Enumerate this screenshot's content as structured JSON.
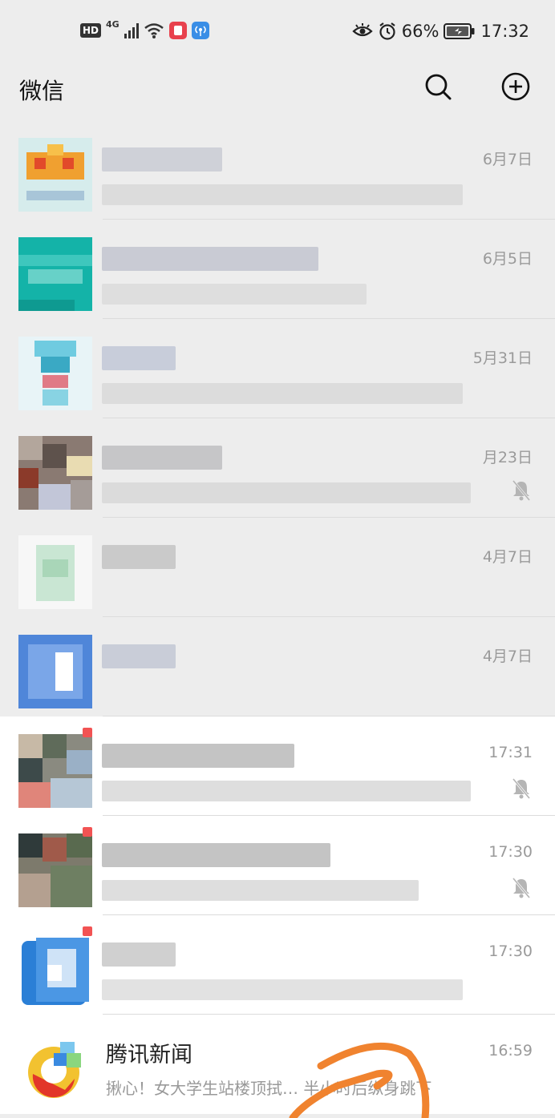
{
  "status_bar": {
    "hd": "HD",
    "network": "4G",
    "battery": "66%",
    "clock": "17:32",
    "icons": [
      "signal-icon",
      "wifi-icon",
      "app-notification-icon",
      "hotspot-icon",
      "eye-comfort-icon",
      "alarm-icon",
      "battery-icon"
    ]
  },
  "header": {
    "title": "微信",
    "icons": [
      "search-icon",
      "add-circle-icon"
    ]
  },
  "chats": [
    {
      "time": "6月7日",
      "muted": false,
      "unread": false
    },
    {
      "time": "6月5日",
      "muted": false,
      "unread": false
    },
    {
      "time": "5月31日",
      "muted": false,
      "unread": false
    },
    {
      "time": "月23日",
      "muted": true,
      "unread": false
    },
    {
      "time": "4月7日",
      "muted": false,
      "unread": false
    },
    {
      "time": "4月7日",
      "muted": false,
      "unread": false
    },
    {
      "time": "17:31",
      "muted": true,
      "unread": true
    },
    {
      "time": "17:30",
      "muted": true,
      "unread": true
    },
    {
      "time": "17:30",
      "muted": false,
      "unread": true
    },
    {
      "name": "腾讯新闻",
      "preview": "揪心！女大学生站楼顶拭… 半小时后纵身跳下",
      "time": "16:59",
      "muted": false,
      "unread": false
    }
  ],
  "colors": {
    "background": "#ededed",
    "unread_dot": "#f25353",
    "time_text": "#9a9a9a",
    "scribble": "#f0832f"
  }
}
